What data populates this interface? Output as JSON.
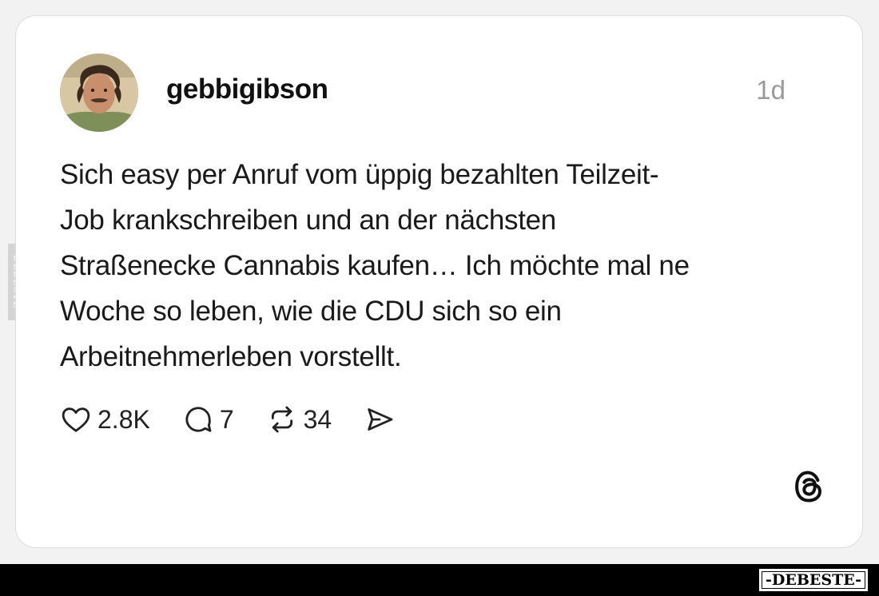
{
  "post": {
    "username": "gebbigibson",
    "time": "1d",
    "lines": [
      "Sich easy per Anruf vom üppig bezahlten Teilzeit-",
      "Job krankschreiben und an der nächsten",
      "Straßenecke Cannabis kaufen… Ich möchte mal ne",
      "Woche so leben, wie die CDU sich so ein",
      "Arbeitnehmerleben vorstellt."
    ],
    "actions": {
      "likes": "2.8K",
      "replies": "7",
      "reposts": "34"
    }
  },
  "icons": [
    "heart-icon",
    "comment-icon",
    "repost-icon",
    "share-icon",
    "threads-logo-icon"
  ],
  "watermark": {
    "side": "DEBESTE",
    "brand": "-DEBESTE-"
  },
  "colors": {
    "background": "#f2f2f2",
    "card": "#ffffff",
    "text": "#1a1a1a",
    "muted": "#9a9a9a",
    "bottom_bar": "#000000"
  }
}
